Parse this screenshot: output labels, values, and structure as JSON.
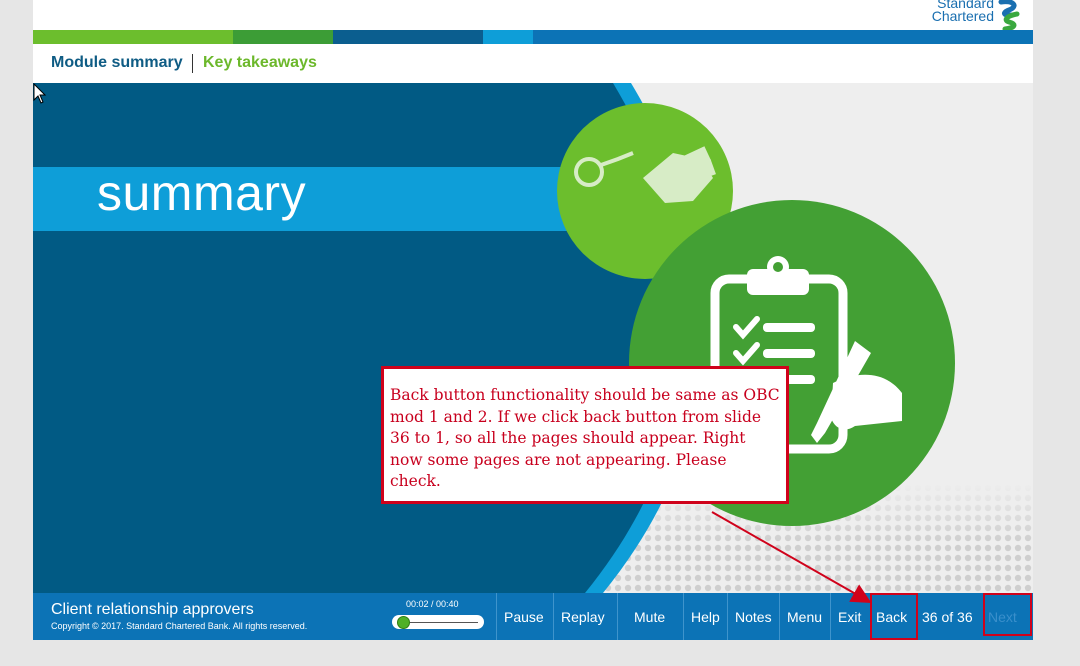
{
  "brand": {
    "logo_line1": "Standard",
    "logo_line2": "Chartered"
  },
  "tabs": {
    "module_summary": "Module summary",
    "key_takeaways": "Key takeaways"
  },
  "slide": {
    "title": "summary"
  },
  "callout": {
    "text": "Back button functionality should be same as OBC mod 1 and 2.  If we click back button from slide 36 to 1, so all the pages should appear. Right now some pages are not appearing. Please check."
  },
  "footer": {
    "course_title": "Client relationship approvers",
    "copyright": "Copyright © 2017. Standard Chartered Bank. All rights reserved.",
    "timecode": "00:02 / 00:40",
    "progress": 0.05,
    "controls": {
      "pause": "Pause",
      "replay": "Replay",
      "mute": "Mute",
      "help": "Help",
      "notes": "Notes",
      "menu": "Menu",
      "exit": "Exit",
      "back": "Back",
      "next": "Next"
    },
    "page_count": "36 of 36"
  },
  "colors": {
    "brand_blue": "#0c73b6",
    "dark_blue": "#015a84",
    "light_blue": "#0e9ed8",
    "green": "#43a034",
    "light_green": "#6cbe2d",
    "annotation_red": "#d0021b"
  },
  "icons": [
    "handcuffs-icon",
    "money-hand-icon",
    "clipboard-checklist-icon",
    "signing-hand-icon",
    "mouse-cursor-icon",
    "standard-chartered-logo"
  ]
}
